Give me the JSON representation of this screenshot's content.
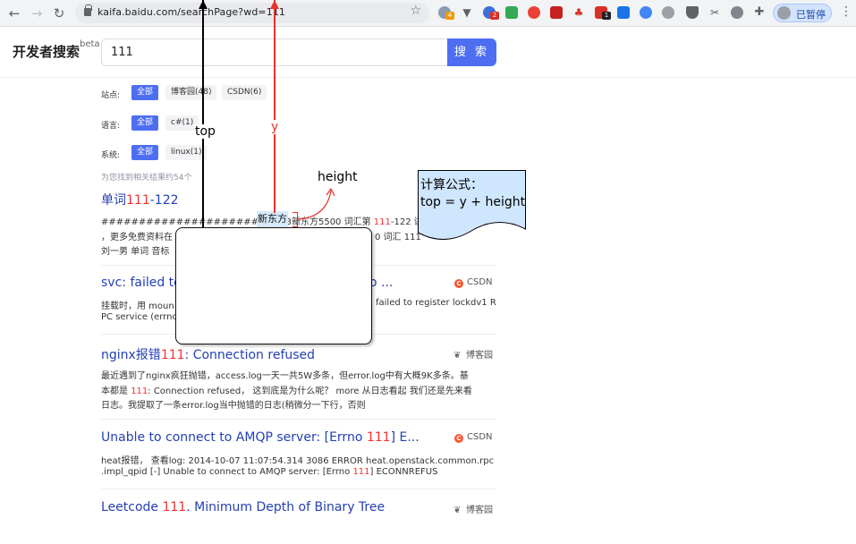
{
  "browser": {
    "url": "kaifa.baidu.com/searchPage?wd=111",
    "paused_label": "已暂停",
    "extension_badges": [
      "4",
      "2",
      "1"
    ]
  },
  "header": {
    "logo": "开发者搜索",
    "logo_sup": "beta",
    "search_value": "111",
    "search_button": "搜 索"
  },
  "filters": [
    {
      "label": "站点:",
      "chips": [
        {
          "text": "全部",
          "active": true
        },
        {
          "text": "博客园(48)"
        },
        {
          "text": "CSDN(6)"
        }
      ]
    },
    {
      "label": "语言:",
      "chips": [
        {
          "text": "全部",
          "active": true
        },
        {
          "text": "c#(1)"
        }
      ]
    },
    {
      "label": "系统:",
      "chips": [
        {
          "text": "全部",
          "active": true
        },
        {
          "text": "linux(1)"
        }
      ]
    }
  ],
  "result_count": "为您找到相关结果约54个",
  "results": [
    {
      "title_pre": "单词",
      "title_hl": "111",
      "title_post": "-122",
      "lines": [
        {
          "pre": "###################### 2013新东方5500 词汇第 ",
          "hl": "111",
          "post": "-122 讲 考研"
        },
        {
          "pre": "，更多免费资料在",
          "hl": "",
          "post": "0 词汇 111"
        },
        {
          "pre": "刘一男 单词 音标",
          "hl": "",
          "post": ""
        }
      ],
      "source": ""
    },
    {
      "title_pre": "svc: failed to",
      "title_hl": "",
      "title_post": "o ...",
      "lines": [
        {
          "pre": "挂载时，用 moun",
          "hl": "",
          "post": "failed to register lockdv1 R"
        },
        {
          "pre": "PC service (errno",
          "hl": "",
          "post": ""
        }
      ],
      "source": "CSDN"
    },
    {
      "title_pre": "nginx报错",
      "title_hl": "111",
      "title_post": ": Connection refused",
      "lines": [
        {
          "pre": "最近遇到了nginx疯狂抛错，access.log一天一共5W多条，但error.log中有大概9K多条。基",
          "hl": "",
          "post": ""
        },
        {
          "pre": "本都是 ",
          "hl": "111",
          "post": ": Connection refused， 这到底是为什么呢？ more 从日志看起 我们还是先来看"
        },
        {
          "pre": "日志。我提取了一条error.log当中抛错的日志(稍微分一下行，否则",
          "hl": "",
          "post": ""
        }
      ],
      "source": "博客园"
    },
    {
      "title_pre": "Unable to connect to AMQP server: [Errno ",
      "title_hl": "111",
      "title_post": "] E...",
      "lines": [
        {
          "pre": "heat报错， 查看log: 2014-10-07 11:07:54.314 3086 ERROR heat.openstack.common.rpc",
          "hl": "",
          "post": ""
        },
        {
          "pre": ".impl_qpid [-] Unable to connect to AMQP server: [Errno ",
          "hl": "111",
          "post": "] ECONNREFUS"
        }
      ],
      "source": "CSDN"
    },
    {
      "title_pre": "Leetcode ",
      "title_hl": "111",
      "title_post": ". Minimum Depth of Binary Tree",
      "lines": [],
      "source": "博客园"
    }
  ],
  "annotations": {
    "top_label": "top",
    "y_label": "y",
    "height_label": "height",
    "keyword": "新东方",
    "formula_line1": "计算公式：",
    "formula_line2": "top = y + height"
  },
  "colors": {
    "accent": "#4e6ef2",
    "link": "#2440b3",
    "highlight": "#f73131",
    "annotation_red": "#e8332a",
    "note_fill": "#cfe6ff"
  }
}
